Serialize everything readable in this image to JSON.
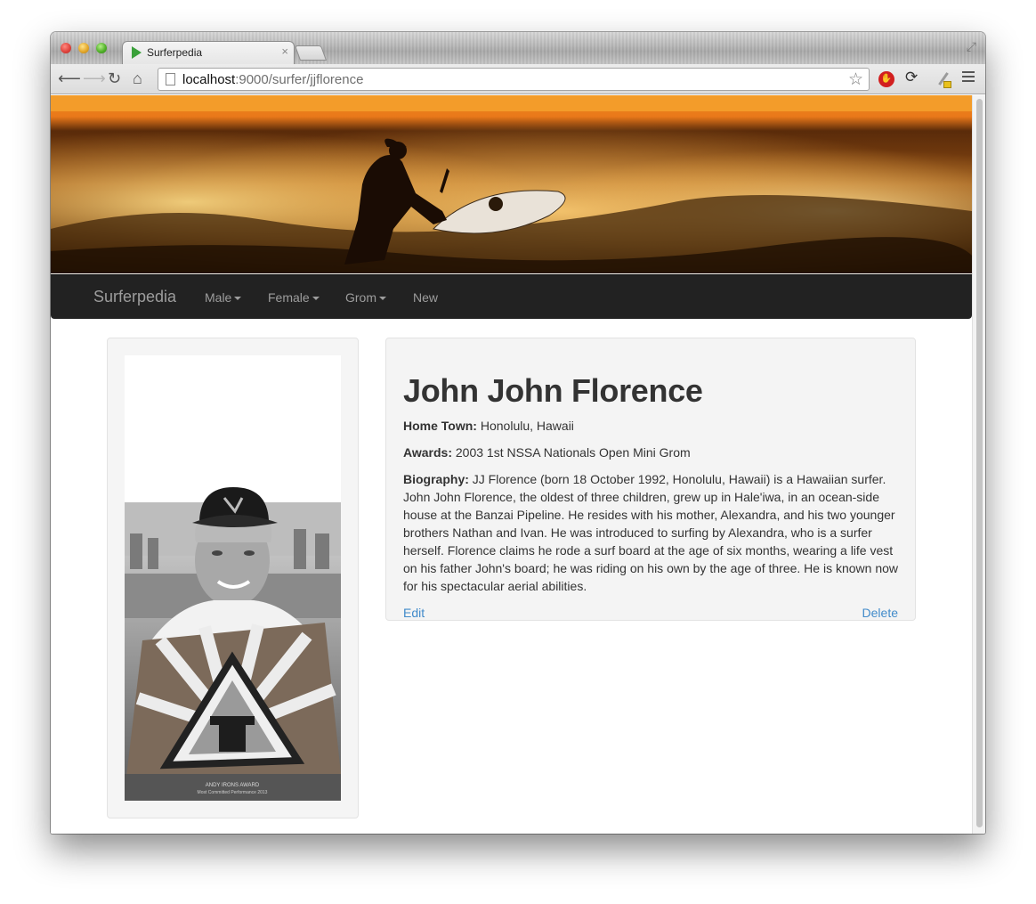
{
  "browser": {
    "tab_title": "Surferpedia",
    "tab_close": "×",
    "url_host": "localhost",
    "url_path": ":9000/surfer/jjflorence"
  },
  "nav": {
    "brand": "Surferpedia",
    "items": [
      {
        "label": "Male",
        "dropdown": true
      },
      {
        "label": "Female",
        "dropdown": true
      },
      {
        "label": "Grom",
        "dropdown": true
      },
      {
        "label": "New",
        "dropdown": false
      }
    ]
  },
  "surfer": {
    "name": "John John Florence",
    "hometown_label": "Home Town:",
    "hometown": "Honolulu, Hawaii",
    "awards_label": "Awards:",
    "awards": "2003 1st NSSA Nationals Open Mini Grom",
    "bio_label": "Biography:",
    "bio": "JJ Florence (born 18 October 1992, Honolulu, Hawaii) is a Hawaiian surfer. John John Florence, the oldest of three children, grew up in Hale'iwa, in an ocean-side house at the Banzai Pipeline. He resides with his mother, Alexandra, and his two younger brothers Nathan and Ivan. He was introduced to surfing by Alexandra, who is a surfer herself. Florence claims he rode a surf board at the age of six months, wearing a life vest on his father John's board; he was riding on his own by the age of three. He is known now for his spectacular aerial abilities."
  },
  "actions": {
    "edit": "Edit",
    "delete": "Delete"
  },
  "photo": {
    "award_text": "ANDY IRONS AWARD",
    "award_subtext": "Most Committed Performance 2013"
  },
  "colors": {
    "navbar_bg": "#222222",
    "nav_text": "#9d9d9d",
    "link": "#428bca",
    "panel_bg": "#f4f4f4"
  }
}
